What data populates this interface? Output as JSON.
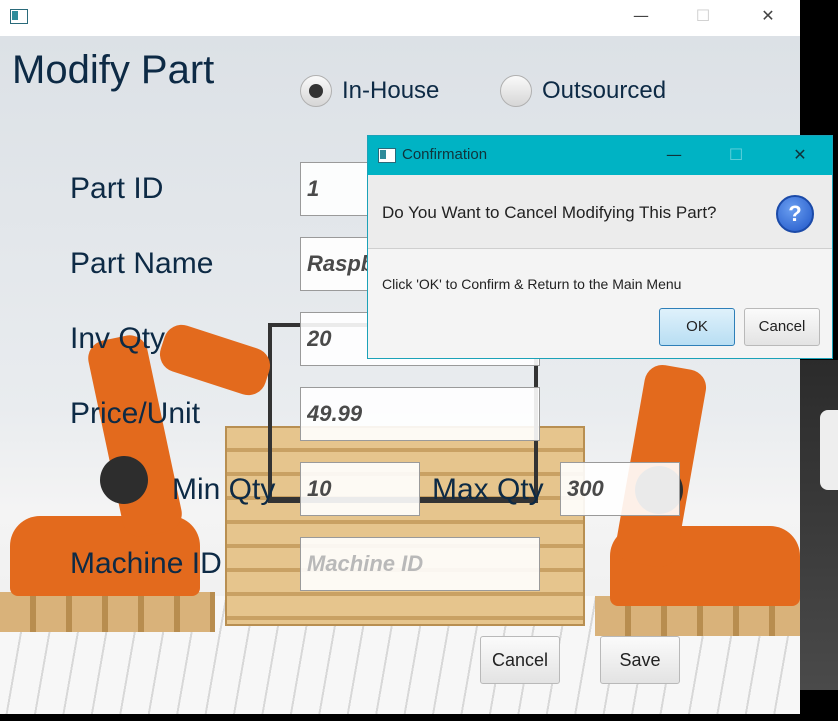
{
  "window": {
    "minimize": "—",
    "maximize": "☐",
    "close": "✕"
  },
  "page": {
    "title": "Modify Part"
  },
  "source": {
    "options": [
      {
        "label": "In-House",
        "selected": true
      },
      {
        "label": "Outsourced",
        "selected": false
      }
    ]
  },
  "form": {
    "part_id": {
      "label": "Part ID",
      "value": "1"
    },
    "part_name": {
      "label": "Part Name",
      "value": "Raspb"
    },
    "inv_qty": {
      "label": "Inv Qty",
      "value": "20"
    },
    "price": {
      "label": "Price/Unit",
      "value": "49.99"
    },
    "min_qty": {
      "label": "Min Qty",
      "value": "10"
    },
    "max_qty": {
      "label": "Max Qty",
      "value": "300"
    },
    "machine_id": {
      "label": "Machine ID",
      "value": "",
      "placeholder": "Machine ID"
    }
  },
  "actions": {
    "cancel": "Cancel",
    "save": "Save"
  },
  "dialog": {
    "title": "Confirmation",
    "header": "Do You Want to Cancel Modifying This Part?",
    "help_glyph": "?",
    "body": "Click 'OK' to Confirm & Return to the Main Menu",
    "ok": "OK",
    "cancel": "Cancel",
    "minimize": "—",
    "maximize": "☐",
    "close": "✕"
  }
}
